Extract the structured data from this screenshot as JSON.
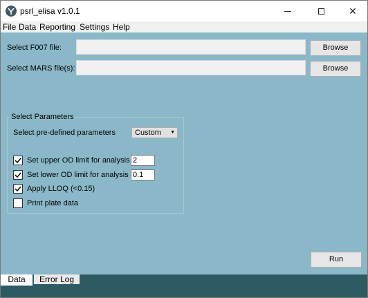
{
  "window": {
    "title": "psrl_elisa v1.0.1",
    "minimize_label": "–",
    "maximize_label": "□",
    "close_label": "✕"
  },
  "menu": {
    "file": "File",
    "data": "Data",
    "reporting": "Reporting",
    "settings": "Settings",
    "help": "Help"
  },
  "files": {
    "f007_label": "Select F007 file:",
    "f007_value": "",
    "mars_label": "Select MARS file(s):",
    "mars_value": "",
    "browse_label": "Browse"
  },
  "parameters": {
    "group_title": "Select Parameters",
    "predefined_label": "Select pre-defined parameters",
    "predefined_value": "Custom",
    "upper_od_label": "Set upper OD limit for analysis",
    "upper_od_checked": true,
    "upper_od_value": "2",
    "lower_od_label": "Set lower OD limit for analysis",
    "lower_od_checked": true,
    "lower_od_value": "0.1",
    "lloq_label": "Apply LLOQ (<0.15)",
    "lloq_checked": true,
    "print_label": "Print plate data",
    "print_checked": false
  },
  "run_label": "Run",
  "tabs": [
    {
      "label": "Data",
      "selected": true
    },
    {
      "label": "Error Log",
      "selected": false
    }
  ],
  "colors": {
    "background": "#8ab8c8",
    "tabbar": "#2d5a63",
    "field": "#f0f0f0"
  }
}
